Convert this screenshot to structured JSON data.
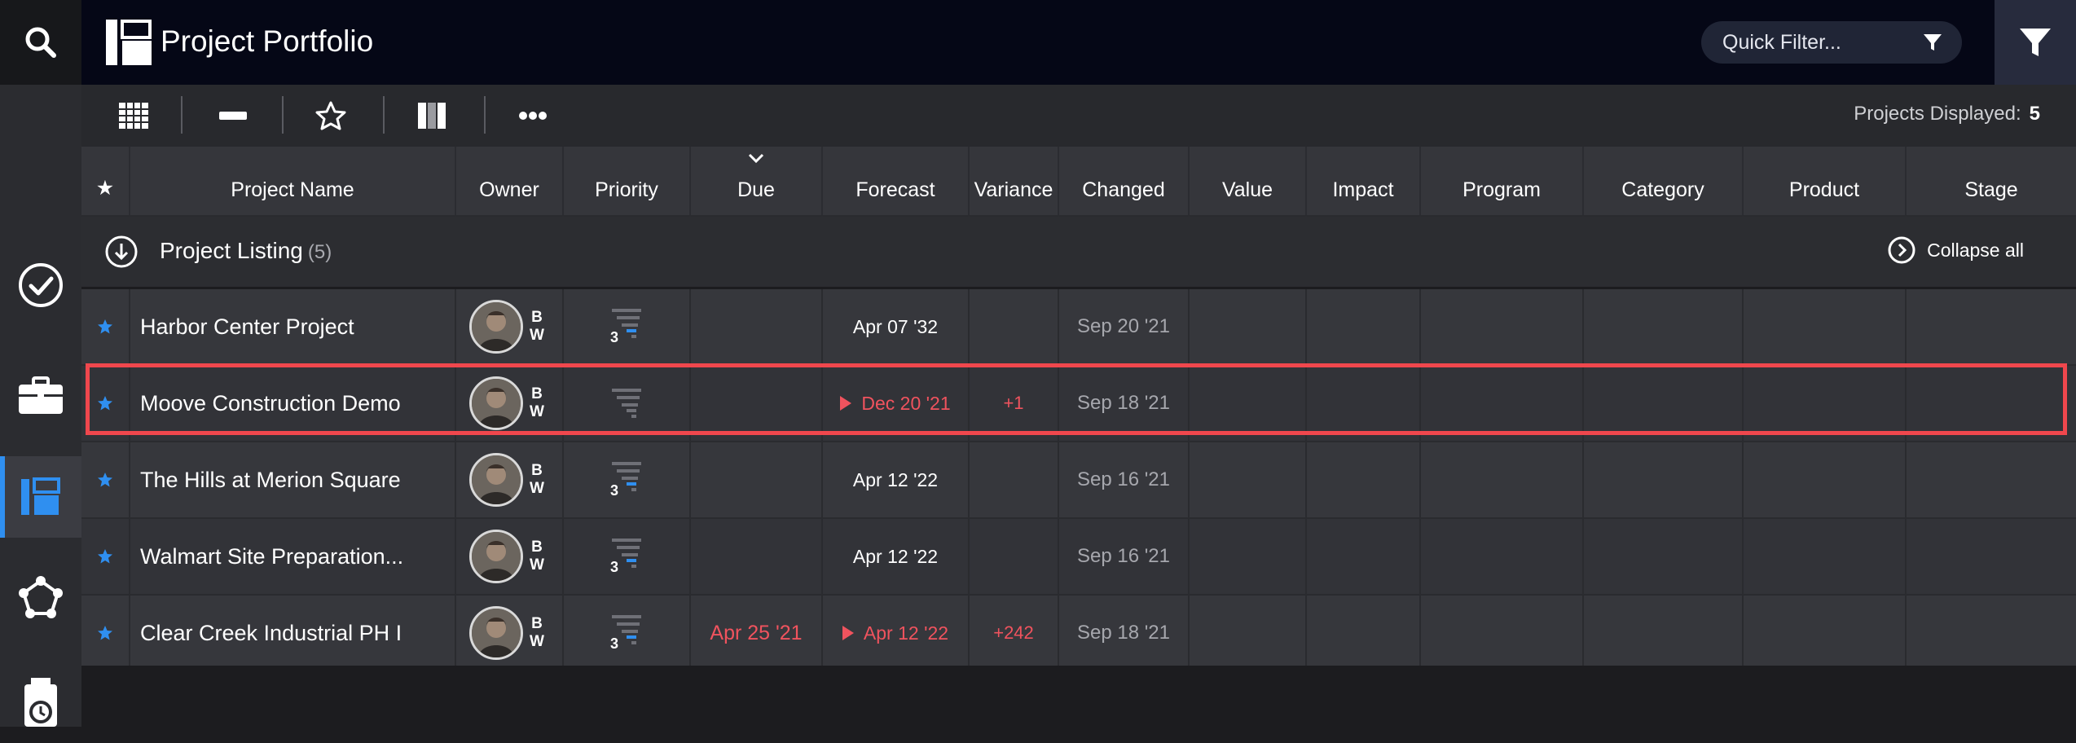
{
  "app": {
    "title": "Project Portfolio"
  },
  "header": {
    "quick_filter_placeholder": "Quick Filter..."
  },
  "toolbar": {
    "projects_displayed_label": "Projects Displayed:",
    "projects_displayed_count": "5"
  },
  "columns": [
    "★",
    "Project Name",
    "Owner",
    "Priority",
    "Due",
    "Forecast",
    "Variance",
    "Changed",
    "Value",
    "Impact",
    "Program",
    "Category",
    "Product",
    "Stage"
  ],
  "group": {
    "title": "Project Listing",
    "count": "(5)",
    "collapse_label": "Collapse all"
  },
  "rows": [
    {
      "name": "Harbor Center Project",
      "owner_initials_1": "B",
      "owner_initials_2": "W",
      "priority": "3",
      "due": "",
      "forecast": "Apr 07 '32",
      "variance": "",
      "changed": "Sep 20 '21"
    },
    {
      "name": "Moove Construction Demo",
      "owner_initials_1": "B",
      "owner_initials_2": "W",
      "priority": "",
      "due": "",
      "forecast": "Dec 20 '21",
      "variance": "+1",
      "changed": "Sep 18 '21"
    },
    {
      "name": "The Hills at Merion Square",
      "owner_initials_1": "B",
      "owner_initials_2": "W",
      "priority": "3",
      "due": "",
      "forecast": "Apr 12 '22",
      "variance": "",
      "changed": "Sep 16 '21"
    },
    {
      "name": "Walmart Site Preparation...",
      "owner_initials_1": "B",
      "owner_initials_2": "W",
      "priority": "3",
      "due": "",
      "forecast": "Apr 12 '22",
      "variance": "",
      "changed": "Sep 16 '21"
    },
    {
      "name": "Clear Creek Industrial PH I",
      "owner_initials_1": "B",
      "owner_initials_2": "W",
      "priority": "3",
      "due": "Apr 25 '21",
      "forecast": "Apr 12 '22",
      "variance": "+242",
      "changed": "Sep 18 '21"
    }
  ],
  "colors": {
    "accent": "#2f8ff0",
    "late": "#f0535e",
    "highlight": "#f0474d",
    "header_bg": "#050716"
  },
  "icons": [
    "search-icon",
    "check-circle-icon",
    "briefcase-icon",
    "portfolio-icon",
    "network-icon",
    "clipboard-clock-icon",
    "filter-icon",
    "grid-view-icon",
    "minus-icon",
    "star-outline-icon",
    "columns-icon",
    "more-icon"
  ]
}
